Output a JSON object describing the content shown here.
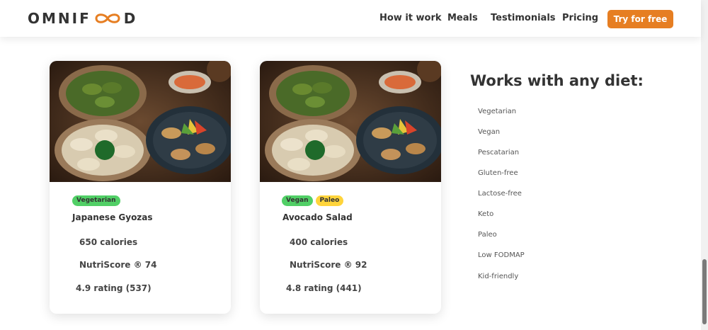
{
  "header": {
    "logo_left": "OMNIF",
    "logo_right": "D",
    "nav": [
      "How it work",
      "Meals",
      "Testimonials",
      "Pricing"
    ],
    "cta_label": "Try for free",
    "accent_color": "#e67e22"
  },
  "meals": [
    {
      "tags": [
        "Vegetarian"
      ],
      "title": "Japanese Gyozas",
      "calories": "650 calories",
      "nutriscore": "NutriScore ® 74",
      "rating": "4.9 rating (537)"
    },
    {
      "tags": [
        "Vegan",
        "Paleo"
      ],
      "title": "Avocado Salad",
      "calories": "400 calories",
      "nutriscore": "NutriScore ® 92",
      "rating": "4.8 rating (441)"
    }
  ],
  "diets": {
    "title": "Works with any diet:",
    "items": [
      "Vegetarian",
      "Vegan",
      "Pescatarian",
      "Gluten-free",
      "Lactose-free",
      "Keto",
      "Paleo",
      "Low FODMAP",
      "Kid-friendly"
    ]
  }
}
